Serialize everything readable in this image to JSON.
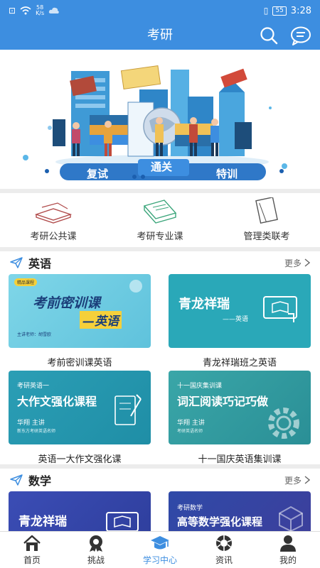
{
  "status": {
    "speed_value": "58",
    "speed_unit": "K/s",
    "battery": "55",
    "time": "3:28"
  },
  "appbar": {
    "title": "考研"
  },
  "banner": {
    "pill_left": "复试",
    "pill_center": "通关",
    "pill_right": "特训"
  },
  "categories": [
    {
      "label": "考研公共课",
      "icon": "books-icon"
    },
    {
      "label": "考研专业课",
      "icon": "notebook-icon"
    },
    {
      "label": "管理类联考",
      "icon": "book-icon"
    }
  ],
  "english": {
    "title": "英语",
    "more": "更多",
    "cards": [
      {
        "label": "考前密训课英语",
        "thumb_title": "考前密训课",
        "thumb_sub": "—英语",
        "thumb_meta": "主讲老师：胡雪欧",
        "tag": "精品课程"
      },
      {
        "label": "青龙祥瑞班之英语",
        "thumb_title": "青龙祥瑞",
        "thumb_sub": "——英语"
      },
      {
        "label": "英语一大作文强化课",
        "thumb_kicker": "考研英语一",
        "thumb_title": "大作文强化课程",
        "thumb_meta": "华翔 主讲",
        "thumb_meta2": "新东方考研英语名师"
      },
      {
        "label": "十一国庆英语集训课",
        "thumb_kicker": "十一国庆集训课",
        "thumb_title": "词汇阅读巧记巧做",
        "thumb_meta": "华翔 主讲",
        "thumb_meta2": "考研英语名师"
      }
    ]
  },
  "math": {
    "title": "数学",
    "more": "更多",
    "cards": [
      {
        "thumb_title": "青龙祥瑞"
      },
      {
        "thumb_kicker": "考研数学",
        "thumb_title": "高等数学强化课程"
      }
    ]
  },
  "tabs": [
    {
      "label": "首页",
      "icon": "home-icon"
    },
    {
      "label": "挑战",
      "icon": "challenge-icon"
    },
    {
      "label": "学习中心",
      "icon": "graduation-cap-icon",
      "active": true
    },
    {
      "label": "资讯",
      "icon": "news-icon"
    },
    {
      "label": "我的",
      "icon": "profile-icon"
    }
  ],
  "colors": {
    "primary": "#3d8ee0",
    "accent_dark": "#1b5faf"
  }
}
